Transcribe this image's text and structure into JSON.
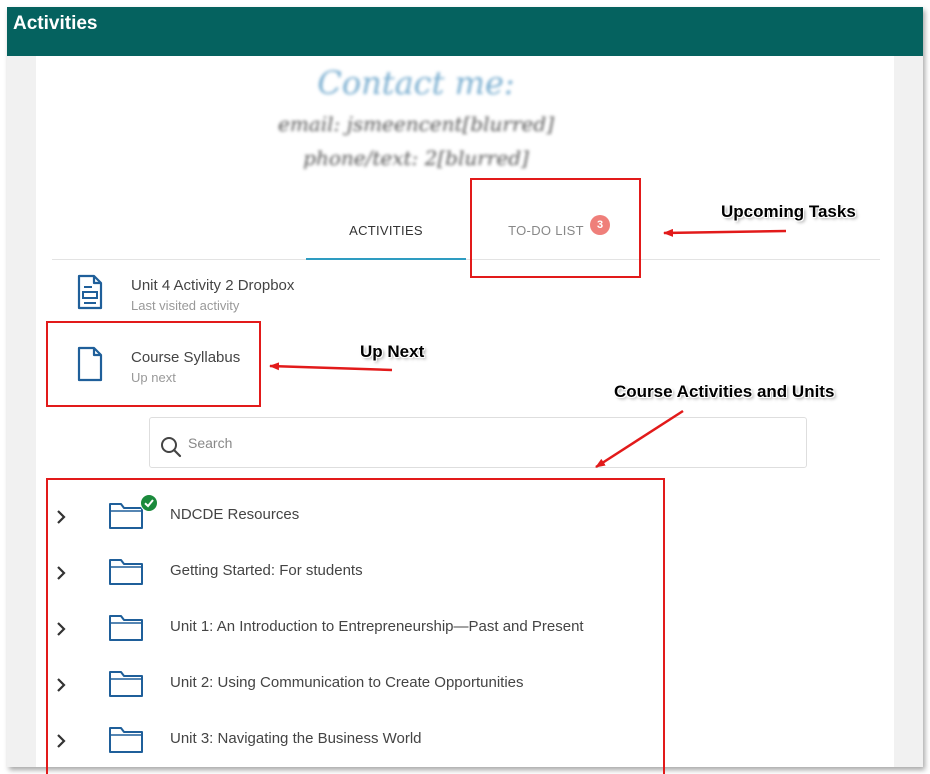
{
  "header": {
    "title": "Activities"
  },
  "contact": {
    "heading": "Contact me:",
    "email": "email: jsmeencent[blurred]",
    "phone": "phone/text: 2[blurred]"
  },
  "tabs": [
    {
      "label": "ACTIVITIES",
      "active": true
    },
    {
      "label": "TO-DO LIST",
      "active": false,
      "badge": "3"
    }
  ],
  "recent": [
    {
      "title": "Unit 4 Activity 2 Dropbox",
      "subtitle": "Last visited activity",
      "icon": "dropbox-document-icon"
    },
    {
      "title": "Course Syllabus",
      "subtitle": "Up next",
      "icon": "document-icon"
    }
  ],
  "search": {
    "placeholder": "Search",
    "value": ""
  },
  "units": [
    {
      "label": "NDCDE Resources",
      "completed": true
    },
    {
      "label": "Getting Started: For students",
      "completed": false
    },
    {
      "label": "Unit 1: An Introduction to Entrepreneurship—Past and Present",
      "completed": false
    },
    {
      "label": "Unit 2: Using Communication to Create Opportunities",
      "completed": false
    },
    {
      "label": "Unit 3: Navigating the Business World",
      "completed": false
    }
  ],
  "annotations": {
    "upcoming_tasks": "Upcoming Tasks",
    "up_next": "Up Next",
    "course_activities": "Course Activities and Units"
  },
  "colors": {
    "header_bg": "#05625f",
    "tab_indicator": "#2e9cc1",
    "badge_bg": "#ef7f7a",
    "icon_blue": "#1f5f9a",
    "check_green": "#1b8a3c",
    "annotation_red": "#e21a1a"
  }
}
